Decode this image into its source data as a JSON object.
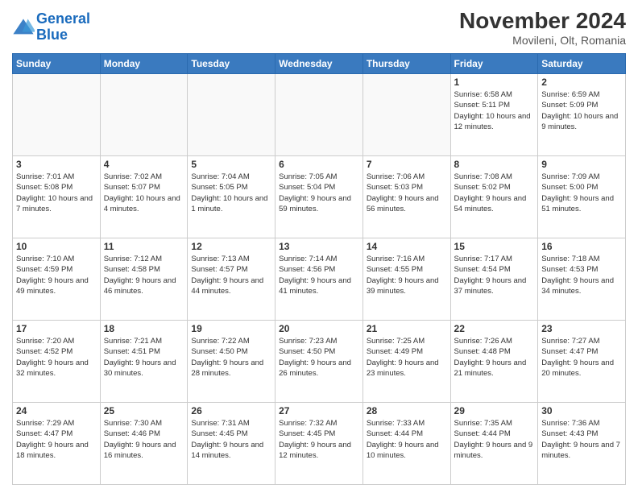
{
  "header": {
    "logo_line1": "General",
    "logo_line2": "Blue",
    "month_year": "November 2024",
    "location": "Movileni, Olt, Romania"
  },
  "days_of_week": [
    "Sunday",
    "Monday",
    "Tuesday",
    "Wednesday",
    "Thursday",
    "Friday",
    "Saturday"
  ],
  "weeks": [
    [
      {
        "day": "",
        "info": ""
      },
      {
        "day": "",
        "info": ""
      },
      {
        "day": "",
        "info": ""
      },
      {
        "day": "",
        "info": ""
      },
      {
        "day": "",
        "info": ""
      },
      {
        "day": "1",
        "info": "Sunrise: 6:58 AM\nSunset: 5:11 PM\nDaylight: 10 hours and 12 minutes."
      },
      {
        "day": "2",
        "info": "Sunrise: 6:59 AM\nSunset: 5:09 PM\nDaylight: 10 hours and 9 minutes."
      }
    ],
    [
      {
        "day": "3",
        "info": "Sunrise: 7:01 AM\nSunset: 5:08 PM\nDaylight: 10 hours and 7 minutes."
      },
      {
        "day": "4",
        "info": "Sunrise: 7:02 AM\nSunset: 5:07 PM\nDaylight: 10 hours and 4 minutes."
      },
      {
        "day": "5",
        "info": "Sunrise: 7:04 AM\nSunset: 5:05 PM\nDaylight: 10 hours and 1 minute."
      },
      {
        "day": "6",
        "info": "Sunrise: 7:05 AM\nSunset: 5:04 PM\nDaylight: 9 hours and 59 minutes."
      },
      {
        "day": "7",
        "info": "Sunrise: 7:06 AM\nSunset: 5:03 PM\nDaylight: 9 hours and 56 minutes."
      },
      {
        "day": "8",
        "info": "Sunrise: 7:08 AM\nSunset: 5:02 PM\nDaylight: 9 hours and 54 minutes."
      },
      {
        "day": "9",
        "info": "Sunrise: 7:09 AM\nSunset: 5:00 PM\nDaylight: 9 hours and 51 minutes."
      }
    ],
    [
      {
        "day": "10",
        "info": "Sunrise: 7:10 AM\nSunset: 4:59 PM\nDaylight: 9 hours and 49 minutes."
      },
      {
        "day": "11",
        "info": "Sunrise: 7:12 AM\nSunset: 4:58 PM\nDaylight: 9 hours and 46 minutes."
      },
      {
        "day": "12",
        "info": "Sunrise: 7:13 AM\nSunset: 4:57 PM\nDaylight: 9 hours and 44 minutes."
      },
      {
        "day": "13",
        "info": "Sunrise: 7:14 AM\nSunset: 4:56 PM\nDaylight: 9 hours and 41 minutes."
      },
      {
        "day": "14",
        "info": "Sunrise: 7:16 AM\nSunset: 4:55 PM\nDaylight: 9 hours and 39 minutes."
      },
      {
        "day": "15",
        "info": "Sunrise: 7:17 AM\nSunset: 4:54 PM\nDaylight: 9 hours and 37 minutes."
      },
      {
        "day": "16",
        "info": "Sunrise: 7:18 AM\nSunset: 4:53 PM\nDaylight: 9 hours and 34 minutes."
      }
    ],
    [
      {
        "day": "17",
        "info": "Sunrise: 7:20 AM\nSunset: 4:52 PM\nDaylight: 9 hours and 32 minutes."
      },
      {
        "day": "18",
        "info": "Sunrise: 7:21 AM\nSunset: 4:51 PM\nDaylight: 9 hours and 30 minutes."
      },
      {
        "day": "19",
        "info": "Sunrise: 7:22 AM\nSunset: 4:50 PM\nDaylight: 9 hours and 28 minutes."
      },
      {
        "day": "20",
        "info": "Sunrise: 7:23 AM\nSunset: 4:50 PM\nDaylight: 9 hours and 26 minutes."
      },
      {
        "day": "21",
        "info": "Sunrise: 7:25 AM\nSunset: 4:49 PM\nDaylight: 9 hours and 23 minutes."
      },
      {
        "day": "22",
        "info": "Sunrise: 7:26 AM\nSunset: 4:48 PM\nDaylight: 9 hours and 21 minutes."
      },
      {
        "day": "23",
        "info": "Sunrise: 7:27 AM\nSunset: 4:47 PM\nDaylight: 9 hours and 20 minutes."
      }
    ],
    [
      {
        "day": "24",
        "info": "Sunrise: 7:29 AM\nSunset: 4:47 PM\nDaylight: 9 hours and 18 minutes."
      },
      {
        "day": "25",
        "info": "Sunrise: 7:30 AM\nSunset: 4:46 PM\nDaylight: 9 hours and 16 minutes."
      },
      {
        "day": "26",
        "info": "Sunrise: 7:31 AM\nSunset: 4:45 PM\nDaylight: 9 hours and 14 minutes."
      },
      {
        "day": "27",
        "info": "Sunrise: 7:32 AM\nSunset: 4:45 PM\nDaylight: 9 hours and 12 minutes."
      },
      {
        "day": "28",
        "info": "Sunrise: 7:33 AM\nSunset: 4:44 PM\nDaylight: 9 hours and 10 minutes."
      },
      {
        "day": "29",
        "info": "Sunrise: 7:35 AM\nSunset: 4:44 PM\nDaylight: 9 hours and 9 minutes."
      },
      {
        "day": "30",
        "info": "Sunrise: 7:36 AM\nSunset: 4:43 PM\nDaylight: 9 hours and 7 minutes."
      }
    ]
  ]
}
